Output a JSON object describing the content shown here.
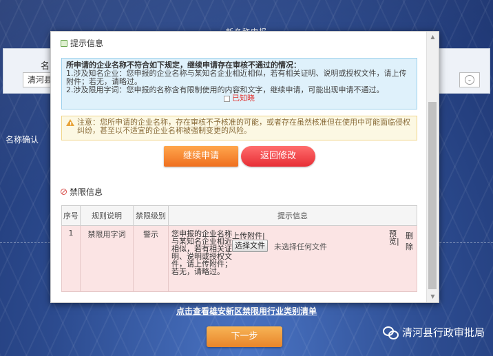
{
  "background": {
    "top_title": "新名称申报",
    "form_label": "名",
    "select_value": "清河县",
    "name_confirm": "名称确认",
    "link_text": "点击查看雄安新区禁限用行业类别清单",
    "next_button": "下一步",
    "watermark_text": "清河县行政审批局"
  },
  "modal": {
    "prompt_section_title": "提示信息",
    "info_title": "所申请的企业名称不符合如下规定，继续申请存在审核不通过的情况：",
    "info_line_1": "1.涉及知名企业：您申报的企业名称与某知名企业相近相似，若有相关证明、说明或授权文件，请上传附件；若无，请略过。",
    "info_line_2": "2.涉及限用字词：您申报的名称含有限制使用的内容和文字，继续申请，可能出现申请不通过。",
    "acknowledge_label": "已知晓",
    "warning_text": "注意：您所申请的企业名称，存在审核不予核准的可能，或者存在虽然核准但在使用中可能面临侵权纠纷，甚至以不适宜的企业名称被强制变更的风险。",
    "continue_button": "继续申请",
    "back_button": "返回修改",
    "restriction_section_title": "禁限信息",
    "table": {
      "headers": [
        "序号",
        "规则说明",
        "禁限级别",
        "提示信息"
      ],
      "rows": [
        {
          "index": "1",
          "rule": "禁限用字词",
          "level": "警示",
          "tip": "您申报的企业名称与某知名企业相近相似，若有相关证明、说明或授权文件，请上传附件；若无，请略过。",
          "upload_label": "上传附件|",
          "choose_file": "选择文件",
          "no_file": "未选择任何文件",
          "preview": "预览|",
          "delete": "删除"
        }
      ]
    }
  },
  "colors": {
    "info_bg": "#dff1fb",
    "warning_bg": "#fcf8e3",
    "continue_button": "#ef6f1f",
    "back_button": "#e72e35",
    "row_bg": "#fbe4e4"
  }
}
